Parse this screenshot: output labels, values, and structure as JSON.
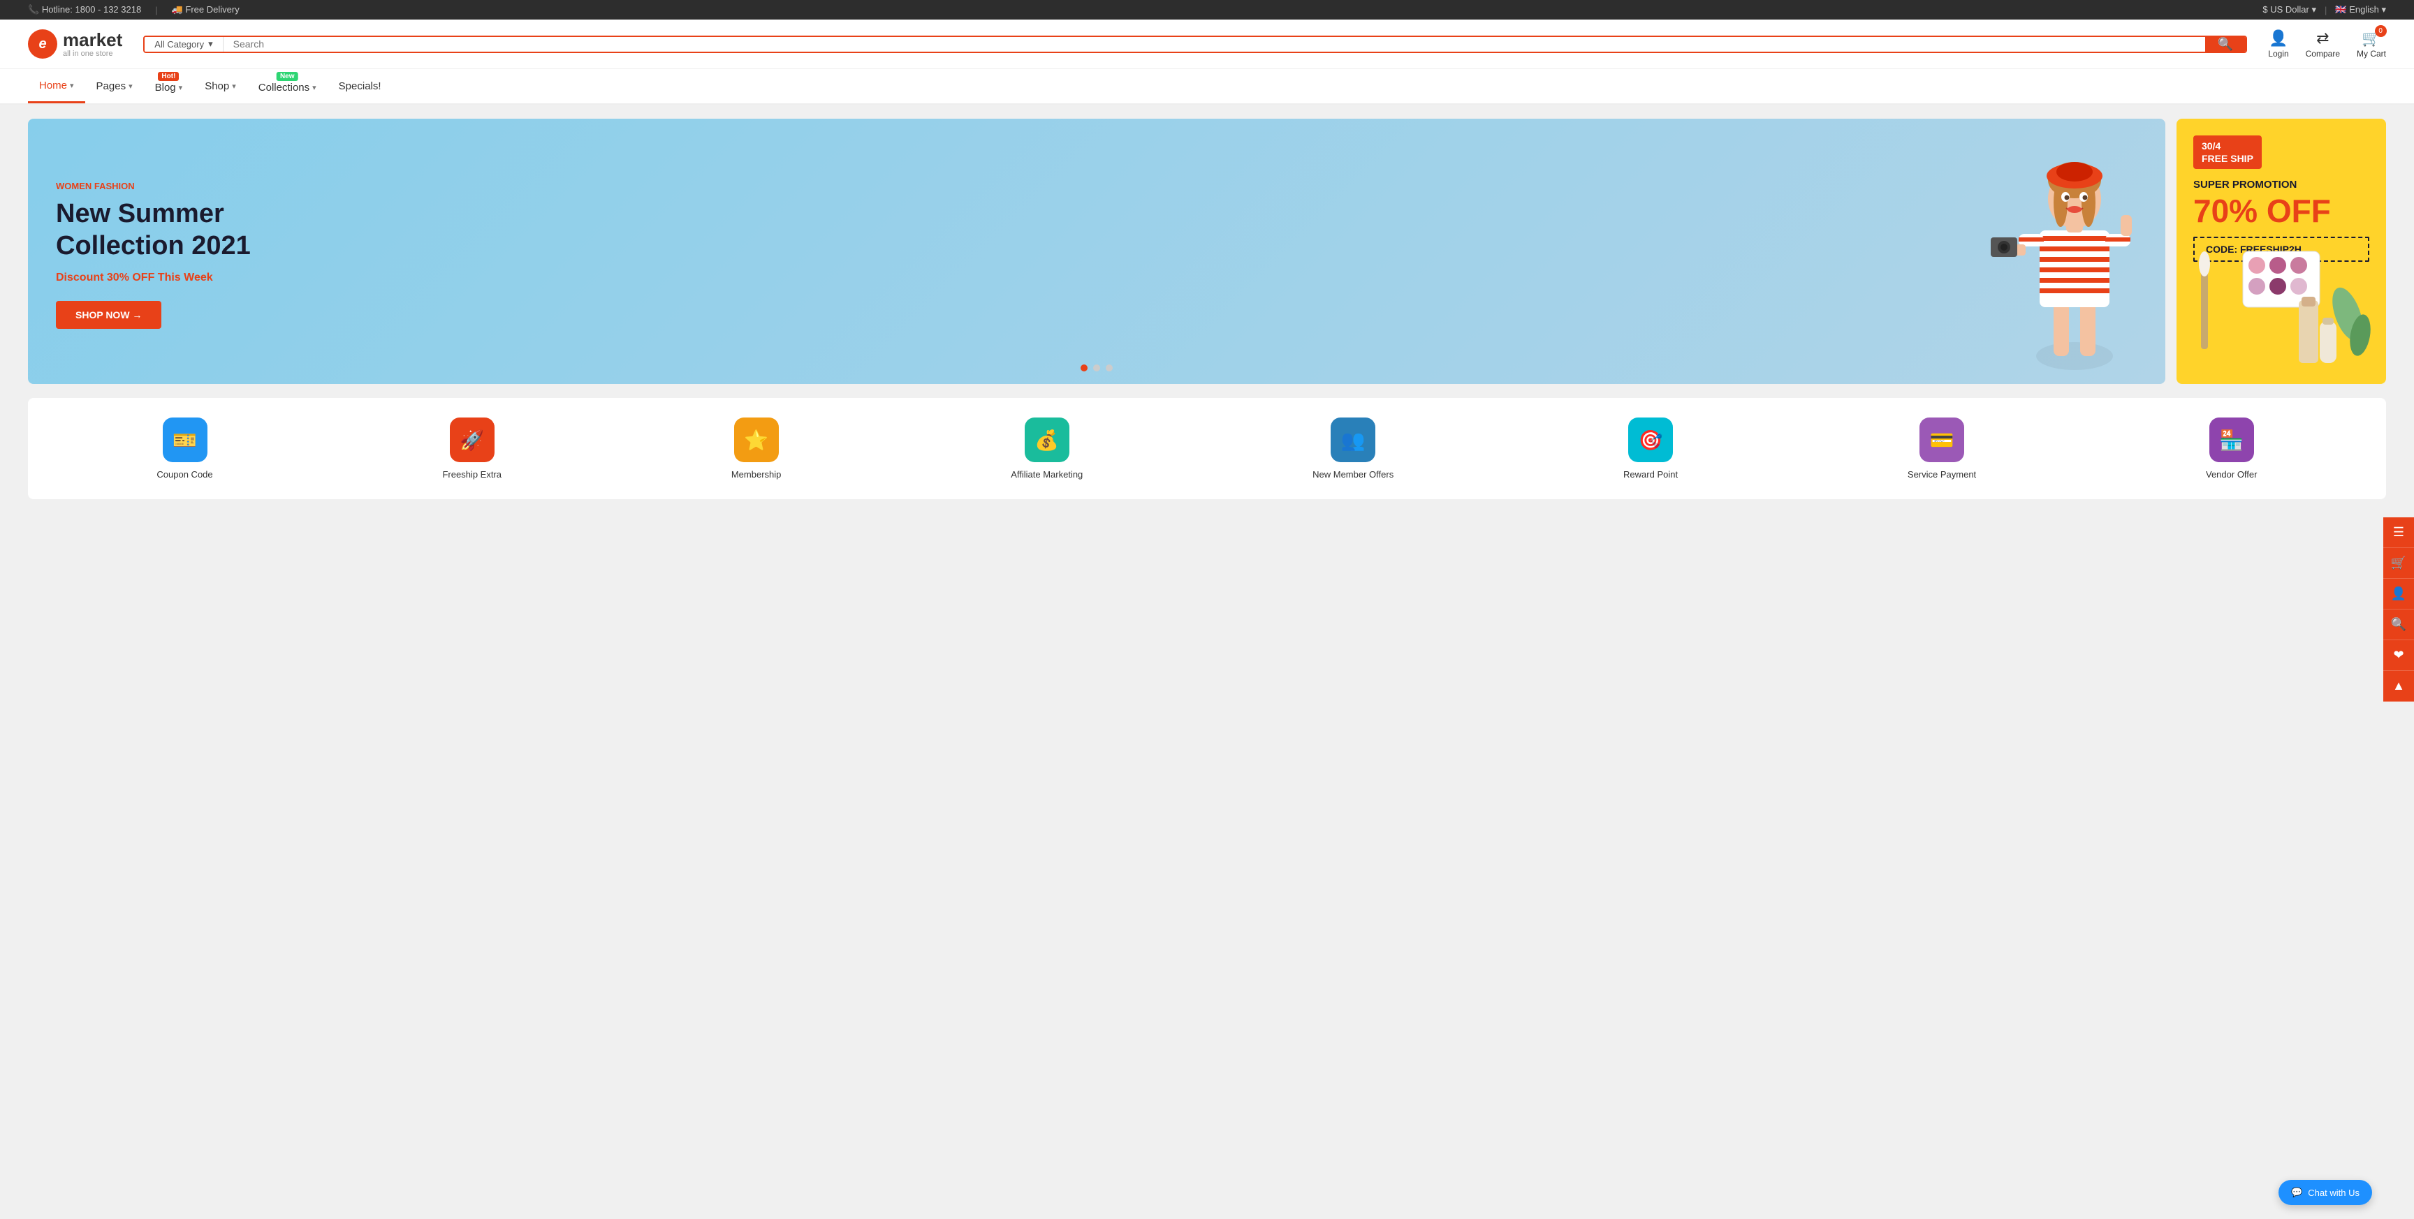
{
  "topbar": {
    "hotline_icon": "📞",
    "hotline_label": "Hotline: 1800 - 132 3218",
    "delivery_icon": "🚚",
    "delivery_label": "Free Delivery",
    "currency_label": "$ US Dollar",
    "flag_icon": "🇬🇧",
    "language_label": "English"
  },
  "header": {
    "logo_letter": "e",
    "logo_brand": "market",
    "logo_sub": "all in one store",
    "search_category": "All Category",
    "search_placeholder": "Search",
    "login_label": "Login",
    "compare_label": "Compare",
    "cart_label": "My Cart",
    "cart_count": "0"
  },
  "nav": {
    "items": [
      {
        "label": "Home",
        "badge": null,
        "active": true
      },
      {
        "label": "Pages",
        "badge": null,
        "active": false
      },
      {
        "label": "Blog",
        "badge": "Hot!",
        "badge_type": "hot",
        "active": false
      },
      {
        "label": "Shop",
        "badge": null,
        "active": false
      },
      {
        "label": "Collections",
        "badge": "New",
        "badge_type": "new",
        "active": false
      },
      {
        "label": "Specials!",
        "badge": null,
        "active": false
      }
    ]
  },
  "main_banner": {
    "category": "WOMEN FASHION",
    "title_line1": "New Summer",
    "title_line2": "Collection 2021",
    "discount_text": "Discount ",
    "discount_value": "30% OFF",
    "discount_suffix": " This Week",
    "cta_label": "SHOP NOW →",
    "dot_count": 3,
    "active_dot": 0
  },
  "side_banner": {
    "free_ship_line1": "30/4",
    "free_ship_line2": "FREE SHIP",
    "super_promo": "SUPER PROMOTION",
    "off_text": "70% OFF",
    "code_label": "CODE: FREESHIP2H"
  },
  "features": [
    {
      "label": "Coupon Code",
      "color": "#2196f3",
      "icon": "🎫"
    },
    {
      "label": "Freeship Extra",
      "color": "#e84118",
      "icon": "🚀"
    },
    {
      "label": "Membership",
      "color": "#f39c12",
      "icon": "⭐"
    },
    {
      "label": "Affiliate Marketing",
      "color": "#1abc9c",
      "icon": "💰"
    },
    {
      "label": "New Member Offers",
      "color": "#2980b9",
      "icon": "👥"
    },
    {
      "label": "Reward Point",
      "color": "#00bcd4",
      "icon": "🎯"
    },
    {
      "label": "Service Payment",
      "color": "#9b59b6",
      "icon": "💳"
    },
    {
      "label": "Vendor Offer",
      "color": "#8e44ad",
      "icon": "🏪"
    }
  ],
  "chat": {
    "label": "Chat with Us",
    "icon": "💬"
  },
  "floating_sidebar": {
    "buttons": [
      "☰",
      "🛒",
      "👤",
      "🔍",
      "❤",
      "▲"
    ]
  }
}
